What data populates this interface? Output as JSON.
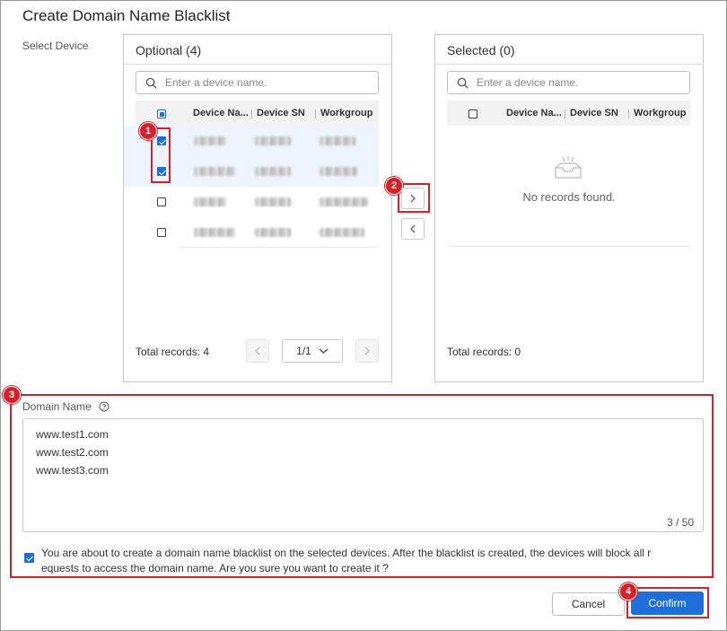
{
  "dialog": {
    "title": "Create Domain Name Blacklist",
    "select_device_label": "Select Device"
  },
  "optional_panel": {
    "title": "Optional (4)",
    "search_placeholder": "Enter a device name.",
    "columns": [
      "Device Na...",
      "Device SN",
      "Workgroup"
    ],
    "rows": [
      {
        "checked": true
      },
      {
        "checked": true
      },
      {
        "checked": false
      },
      {
        "checked": false
      }
    ],
    "total_records": "Total records: 4",
    "page": "1/1"
  },
  "selected_panel": {
    "title": "Selected (0)",
    "search_placeholder": "Enter a device name.",
    "columns": [
      "Device Na...",
      "Device SN",
      "Workgroup"
    ],
    "empty_text": "No records found.",
    "total_records": "Total records: 0"
  },
  "domain": {
    "label": "Domain Name",
    "lines": [
      "www.test1.com",
      "www.test2.com",
      "www.test3.com"
    ],
    "counter": "3 / 50",
    "confirm_checked": true,
    "confirm_text_line1": "You are about to create a domain name blacklist on the selected devices. After the blacklist is created, the devices will block all r",
    "confirm_text_line2": "equests to access the domain name. Are you sure you want to create it ?"
  },
  "footer": {
    "cancel_label": "Cancel",
    "confirm_label": "Confirm"
  },
  "annotations": {
    "badge_1": "1",
    "badge_2": "2",
    "badge_3": "3",
    "badge_4": "4"
  },
  "colors": {
    "accent": "#1e6fd9",
    "annotation_red": "#d6202a"
  },
  "icons": [
    "search-icon",
    "chevron-down-icon",
    "chevron-left-icon",
    "chevron-right-icon",
    "empty-inbox-icon",
    "help-circle-icon",
    "check-icon"
  ]
}
